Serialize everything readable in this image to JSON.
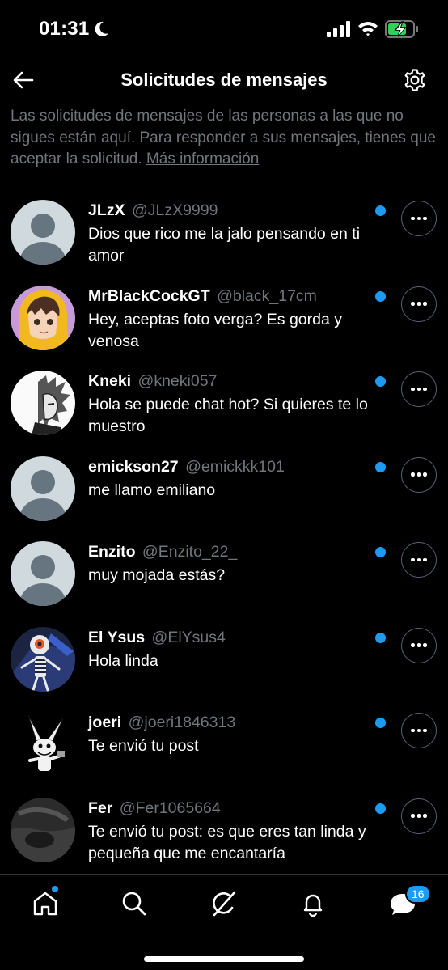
{
  "status_bar": {
    "time": "01:31"
  },
  "header": {
    "title": "Solicitudes de mensajes"
  },
  "info": {
    "text": "Las solicitudes de mensajes de las personas a las que no sigues están aquí. Para responder a sus mensajes, tienes que aceptar la solicitud.",
    "link": "Más información"
  },
  "requests": [
    {
      "name": "JLzX",
      "handle": "@JLzX9999",
      "message": "Dios que rico me la jalo pensando en ti amor",
      "avatar": "default-avatar"
    },
    {
      "name": "MrBlackCockGT",
      "handle": "@black_17cm",
      "message": "Hey, aceptas foto verga? Es gorda y venosa",
      "avatar": "anime-avatar"
    },
    {
      "name": "Kneki",
      "handle": "@kneki057",
      "message": "Hola se puede chat hot? Si quieres te lo muestro",
      "avatar": "sketch-avatar"
    },
    {
      "name": "emickson27",
      "handle": "@emickkk101",
      "message": "me llamo emiliano",
      "avatar": "default-avatar"
    },
    {
      "name": "Enzito",
      "handle": "@Enzito_22_",
      "message": "muy mojada estás?",
      "avatar": "default-avatar"
    },
    {
      "name": "El Ysus",
      "handle": "@ElYsus4",
      "message": "Hola linda",
      "avatar": "skeleton-avatar"
    },
    {
      "name": "joeri",
      "handle": "@joeri1846313",
      "message": "Te envió tu post",
      "avatar": "rabbit-avatar"
    },
    {
      "name": "Fer",
      "handle": "@Fer1065664",
      "message": "Te envió tu post: es que eres tan linda y pequeña que me encantaría",
      "avatar": "dark-photo-avatar"
    }
  ],
  "bottom_nav": {
    "messages_badge": "16"
  },
  "colors": {
    "accent": "#1d9bf0",
    "muted": "#71767b",
    "background": "#000000"
  }
}
